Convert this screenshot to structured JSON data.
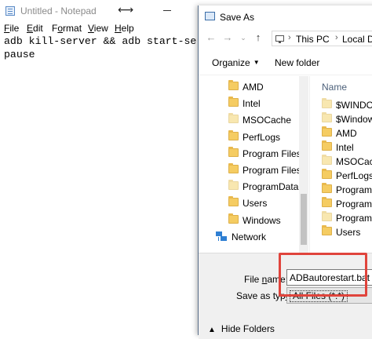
{
  "notepad": {
    "title": "Untitled - Notepad",
    "menu": [
      {
        "label": "File",
        "underline_index": 0
      },
      {
        "label": "Edit",
        "underline_index": 0
      },
      {
        "label": "Format",
        "underline_index": 1
      },
      {
        "label": "View",
        "underline_index": 0
      },
      {
        "label": "Help",
        "underline_index": 0
      }
    ],
    "lines": [
      "adb kill-server && adb start-server",
      "pause"
    ]
  },
  "dialog": {
    "title": "Save As",
    "address": {
      "parts": [
        "This PC",
        "Local D"
      ]
    },
    "toolbar": {
      "organize": "Organize",
      "new_folder": "New folder"
    },
    "tree": {
      "items": [
        {
          "label": "AMD",
          "icon": "folder-icon"
        },
        {
          "label": "Intel",
          "icon": "folder-icon"
        },
        {
          "label": "MSOCache",
          "icon": "folder-icon",
          "pale": true
        },
        {
          "label": "PerfLogs",
          "icon": "folder-icon"
        },
        {
          "label": "Program Files",
          "icon": "folder-icon"
        },
        {
          "label": "Program Files (",
          "icon": "folder-icon"
        },
        {
          "label": "ProgramData",
          "icon": "folder-icon",
          "pale": true
        },
        {
          "label": "Users",
          "icon": "folder-icon"
        },
        {
          "label": "Windows",
          "icon": "folder-icon"
        }
      ],
      "network": "Network"
    },
    "list": {
      "column": "Name",
      "items": [
        {
          "label": "$WINDOW",
          "icon": "folder-icon",
          "pale": true
        },
        {
          "label": "$Windows",
          "icon": "folder-icon",
          "pale": true
        },
        {
          "label": "AMD",
          "icon": "folder-icon"
        },
        {
          "label": "Intel",
          "icon": "folder-icon"
        },
        {
          "label": "MSOCach",
          "icon": "folder-icon",
          "pale": true
        },
        {
          "label": "PerfLogs",
          "icon": "folder-icon"
        },
        {
          "label": "Program F",
          "icon": "folder-icon"
        },
        {
          "label": "Program F",
          "icon": "folder-icon"
        },
        {
          "label": "ProgramD",
          "icon": "folder-icon",
          "pale": true
        },
        {
          "label": "Users",
          "icon": "folder-icon"
        }
      ]
    },
    "file_name_label": "File name:",
    "file_name_value": "ADBautorestart.bat",
    "save_as_type_label": "Save as type:",
    "save_as_type_value": "All Files  (*.*)",
    "hide_folders": "Hide Folders"
  },
  "colors": {
    "highlight": "#e0443c",
    "network": "#2f7fd3",
    "folder": "#f5cc62"
  }
}
